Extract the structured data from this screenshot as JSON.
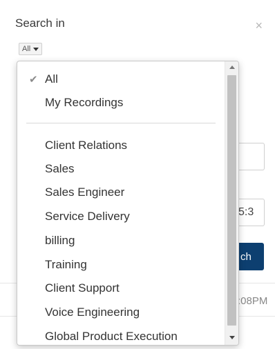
{
  "header": {
    "title": "Search in",
    "close_icon": "close-icon"
  },
  "scope": {
    "selected": "All"
  },
  "background": {
    "time_value": "5:3",
    "search_label": "ch",
    "time_text": ":08PM"
  },
  "dropdown": {
    "items": [
      {
        "label": "All",
        "checked": true
      },
      {
        "label": "My Recordings"
      },
      {
        "label": "Client Relations"
      },
      {
        "label": "Sales"
      },
      {
        "label": "Sales Engineer"
      },
      {
        "label": "Service Delivery"
      },
      {
        "label": "billing"
      },
      {
        "label": "Training"
      },
      {
        "label": "Client Support"
      },
      {
        "label": "Voice Engineering"
      },
      {
        "label": "Global Product Execution"
      }
    ]
  },
  "colors": {
    "accent": "#0d3f70",
    "check": "#8a8a8a"
  }
}
